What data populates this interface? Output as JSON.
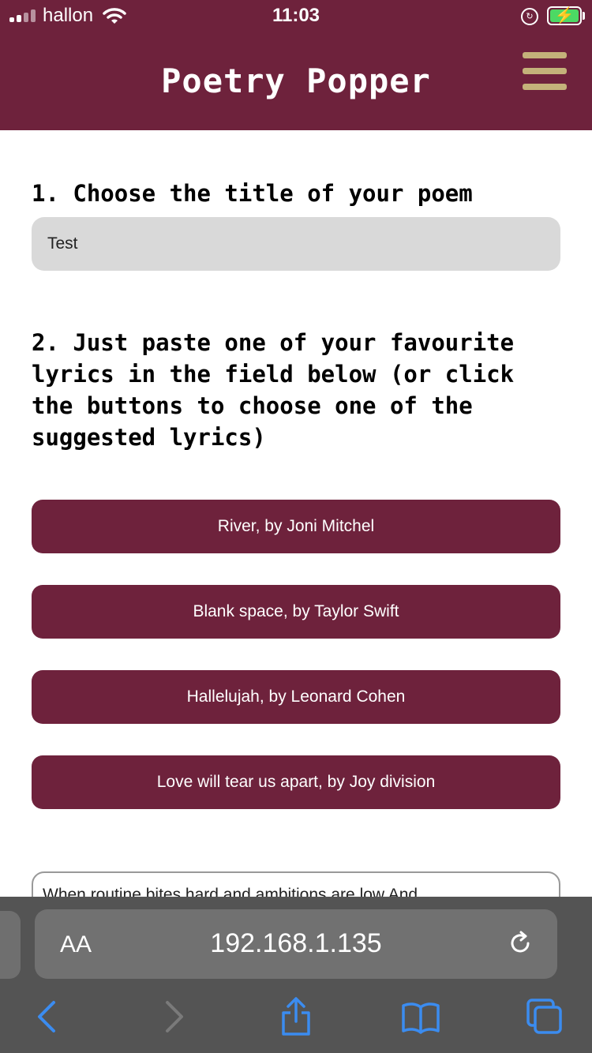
{
  "status_bar": {
    "carrier": "hallon",
    "time": "11:03"
  },
  "header": {
    "app_title": "Poetry Popper",
    "menu_icon": "hamburger-menu-icon"
  },
  "step1": {
    "title": "1. Choose the title of your poem",
    "title_value": "Test"
  },
  "step2": {
    "title": "2. Just paste one of your favourite lyrics in the field below (or click the buttons to choose one of the suggested lyrics)",
    "buttons": [
      "River, by Joni Mitchel",
      "Blank space, by Taylor Swift",
      "Hallelujah, by Leonard Cohen",
      "Love will tear us apart, by Joy division"
    ],
    "lyrics_text": "When routine bites hard and ambitions are low And"
  },
  "browser": {
    "text_size_label": "AA",
    "url": "192.168.1.135",
    "icons": [
      "back-icon",
      "forward-icon",
      "share-icon",
      "bookmarks-icon",
      "tabs-icon",
      "reload-icon"
    ]
  },
  "colors": {
    "brand": "#6e223c",
    "menu_accent": "#c4b27a",
    "input_bg": "#d9d9d9",
    "link_blue": "#3b8cf0"
  }
}
